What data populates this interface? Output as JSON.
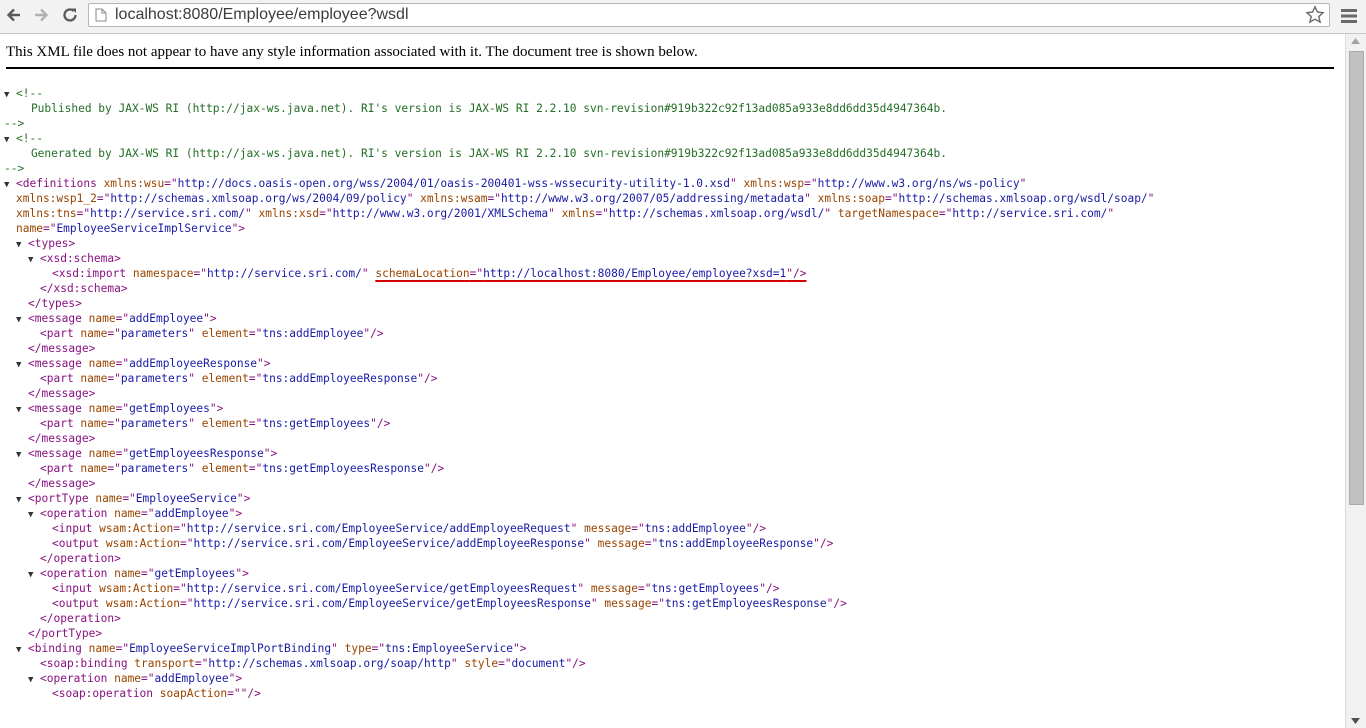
{
  "browser": {
    "url": "localhost:8080/Employee/employee?wsdl"
  },
  "info_text": "This XML file does not appear to have any style information associated with it. The document tree is shown below.",
  "lines": [
    {
      "indent": 0,
      "toggle": "▼",
      "parts": [
        {
          "c": "cm",
          "t": "<!--"
        }
      ]
    },
    {
      "indent": 0,
      "toggle": "",
      "parts": [
        {
          "c": "cm",
          "t": "    Published by JAX-WS RI (http://jax-ws.java.net). RI's version is JAX-WS RI 2.2.10 svn-revision#919b322c92f13ad085a933e8dd6dd35d4947364b."
        }
      ]
    },
    {
      "indent": 0,
      "toggle": "",
      "parts": [
        {
          "c": "cm",
          "t": "-->"
        }
      ]
    },
    {
      "indent": 0,
      "toggle": "▼",
      "parts": [
        {
          "c": "cm",
          "t": "<!--"
        }
      ]
    },
    {
      "indent": 0,
      "toggle": "",
      "parts": [
        {
          "c": "cm",
          "t": "    Generated by JAX-WS RI (http://jax-ws.java.net). RI's version is JAX-WS RI 2.2.10 svn-revision#919b322c92f13ad085a933e8dd6dd35d4947364b."
        }
      ]
    },
    {
      "indent": 0,
      "toggle": "",
      "parts": [
        {
          "c": "cm",
          "t": "-->"
        }
      ]
    },
    {
      "indent": 0,
      "toggle": "▼",
      "parts": [
        {
          "c": "tag",
          "t": "<definitions"
        },
        {
          "c": "an",
          "t": " xmlns:wsu"
        },
        {
          "c": "tag",
          "t": "=\""
        },
        {
          "c": "av",
          "t": "http://docs.oasis-open.org/wss/2004/01/oasis-200401-wss-wssecurity-utility-1.0.xsd"
        },
        {
          "c": "tag",
          "t": "\""
        },
        {
          "c": "an",
          "t": " xmlns:wsp"
        },
        {
          "c": "tag",
          "t": "=\""
        },
        {
          "c": "av",
          "t": "http://www.w3.org/ns/ws-policy"
        },
        {
          "c": "tag",
          "t": "\""
        }
      ]
    },
    {
      "indent": 1,
      "toggle": "",
      "parts": [
        {
          "c": "an",
          "t": "xmlns:wsp1_2"
        },
        {
          "c": "tag",
          "t": "=\""
        },
        {
          "c": "av",
          "t": "http://schemas.xmlsoap.org/ws/2004/09/policy"
        },
        {
          "c": "tag",
          "t": "\""
        },
        {
          "c": "an",
          "t": " xmlns:wsam"
        },
        {
          "c": "tag",
          "t": "=\""
        },
        {
          "c": "av",
          "t": "http://www.w3.org/2007/05/addressing/metadata"
        },
        {
          "c": "tag",
          "t": "\""
        },
        {
          "c": "an",
          "t": " xmlns:soap"
        },
        {
          "c": "tag",
          "t": "=\""
        },
        {
          "c": "av",
          "t": "http://schemas.xmlsoap.org/wsdl/soap/"
        },
        {
          "c": "tag",
          "t": "\""
        }
      ]
    },
    {
      "indent": 1,
      "toggle": "",
      "parts": [
        {
          "c": "an",
          "t": "xmlns:tns"
        },
        {
          "c": "tag",
          "t": "=\""
        },
        {
          "c": "av",
          "t": "http://service.sri.com/"
        },
        {
          "c": "tag",
          "t": "\""
        },
        {
          "c": "an",
          "t": " xmlns:xsd"
        },
        {
          "c": "tag",
          "t": "=\""
        },
        {
          "c": "av",
          "t": "http://www.w3.org/2001/XMLSchema"
        },
        {
          "c": "tag",
          "t": "\""
        },
        {
          "c": "an",
          "t": " xmlns"
        },
        {
          "c": "tag",
          "t": "=\""
        },
        {
          "c": "av",
          "t": "http://schemas.xmlsoap.org/wsdl/"
        },
        {
          "c": "tag",
          "t": "\""
        },
        {
          "c": "an",
          "t": " targetNamespace"
        },
        {
          "c": "tag",
          "t": "=\""
        },
        {
          "c": "av",
          "t": "http://service.sri.com/"
        },
        {
          "c": "tag",
          "t": "\""
        }
      ]
    },
    {
      "indent": 1,
      "toggle": "",
      "parts": [
        {
          "c": "an",
          "t": "name"
        },
        {
          "c": "tag",
          "t": "=\""
        },
        {
          "c": "av",
          "t": "EmployeeServiceImplService"
        },
        {
          "c": "tag",
          "t": "\">"
        }
      ]
    },
    {
      "indent": 1,
      "toggle": "▼",
      "parts": [
        {
          "c": "tag",
          "t": "<types>"
        }
      ]
    },
    {
      "indent": 2,
      "toggle": "▼",
      "parts": [
        {
          "c": "tag",
          "t": "<xsd:schema>"
        }
      ]
    },
    {
      "indent": 4,
      "toggle": "",
      "parts": [
        {
          "c": "tag",
          "t": "<xsd:import"
        },
        {
          "c": "an",
          "t": " namespace"
        },
        {
          "c": "tag",
          "t": "=\""
        },
        {
          "c": "av",
          "t": "http://service.sri.com/"
        },
        {
          "c": "tag",
          "t": "\" "
        },
        {
          "c": "an",
          "t": "schemaLocation",
          "u": 1
        },
        {
          "c": "tag",
          "t": "=\"",
          "u": 1
        },
        {
          "c": "av",
          "t": "http://localhost:8080/Employee/employee?xsd=1",
          "u": 1
        },
        {
          "c": "tag",
          "t": "\"/>",
          "u": 1
        }
      ]
    },
    {
      "indent": 3,
      "toggle": "",
      "parts": [
        {
          "c": "tag",
          "t": "</xsd:schema>"
        }
      ]
    },
    {
      "indent": 2,
      "toggle": "",
      "parts": [
        {
          "c": "tag",
          "t": "</types>"
        }
      ]
    },
    {
      "indent": 1,
      "toggle": "▼",
      "parts": [
        {
          "c": "tag",
          "t": "<message"
        },
        {
          "c": "an",
          "t": " name"
        },
        {
          "c": "tag",
          "t": "=\""
        },
        {
          "c": "av",
          "t": "addEmployee"
        },
        {
          "c": "tag",
          "t": "\">"
        }
      ]
    },
    {
      "indent": 3,
      "toggle": "",
      "parts": [
        {
          "c": "tag",
          "t": "<part"
        },
        {
          "c": "an",
          "t": " name"
        },
        {
          "c": "tag",
          "t": "=\""
        },
        {
          "c": "av",
          "t": "parameters"
        },
        {
          "c": "tag",
          "t": "\""
        },
        {
          "c": "an",
          "t": " element"
        },
        {
          "c": "tag",
          "t": "=\""
        },
        {
          "c": "av",
          "t": "tns:addEmployee"
        },
        {
          "c": "tag",
          "t": "\"/>"
        }
      ]
    },
    {
      "indent": 2,
      "toggle": "",
      "parts": [
        {
          "c": "tag",
          "t": "</message>"
        }
      ]
    },
    {
      "indent": 1,
      "toggle": "▼",
      "parts": [
        {
          "c": "tag",
          "t": "<message"
        },
        {
          "c": "an",
          "t": " name"
        },
        {
          "c": "tag",
          "t": "=\""
        },
        {
          "c": "av",
          "t": "addEmployeeResponse"
        },
        {
          "c": "tag",
          "t": "\">"
        }
      ]
    },
    {
      "indent": 3,
      "toggle": "",
      "parts": [
        {
          "c": "tag",
          "t": "<part"
        },
        {
          "c": "an",
          "t": " name"
        },
        {
          "c": "tag",
          "t": "=\""
        },
        {
          "c": "av",
          "t": "parameters"
        },
        {
          "c": "tag",
          "t": "\""
        },
        {
          "c": "an",
          "t": " element"
        },
        {
          "c": "tag",
          "t": "=\""
        },
        {
          "c": "av",
          "t": "tns:addEmployeeResponse"
        },
        {
          "c": "tag",
          "t": "\"/>"
        }
      ]
    },
    {
      "indent": 2,
      "toggle": "",
      "parts": [
        {
          "c": "tag",
          "t": "</message>"
        }
      ]
    },
    {
      "indent": 1,
      "toggle": "▼",
      "parts": [
        {
          "c": "tag",
          "t": "<message"
        },
        {
          "c": "an",
          "t": " name"
        },
        {
          "c": "tag",
          "t": "=\""
        },
        {
          "c": "av",
          "t": "getEmployees"
        },
        {
          "c": "tag",
          "t": "\">"
        }
      ]
    },
    {
      "indent": 3,
      "toggle": "",
      "parts": [
        {
          "c": "tag",
          "t": "<part"
        },
        {
          "c": "an",
          "t": " name"
        },
        {
          "c": "tag",
          "t": "=\""
        },
        {
          "c": "av",
          "t": "parameters"
        },
        {
          "c": "tag",
          "t": "\""
        },
        {
          "c": "an",
          "t": " element"
        },
        {
          "c": "tag",
          "t": "=\""
        },
        {
          "c": "av",
          "t": "tns:getEmployees"
        },
        {
          "c": "tag",
          "t": "\"/>"
        }
      ]
    },
    {
      "indent": 2,
      "toggle": "",
      "parts": [
        {
          "c": "tag",
          "t": "</message>"
        }
      ]
    },
    {
      "indent": 1,
      "toggle": "▼",
      "parts": [
        {
          "c": "tag",
          "t": "<message"
        },
        {
          "c": "an",
          "t": " name"
        },
        {
          "c": "tag",
          "t": "=\""
        },
        {
          "c": "av",
          "t": "getEmployeesResponse"
        },
        {
          "c": "tag",
          "t": "\">"
        }
      ]
    },
    {
      "indent": 3,
      "toggle": "",
      "parts": [
        {
          "c": "tag",
          "t": "<part"
        },
        {
          "c": "an",
          "t": " name"
        },
        {
          "c": "tag",
          "t": "=\""
        },
        {
          "c": "av",
          "t": "parameters"
        },
        {
          "c": "tag",
          "t": "\""
        },
        {
          "c": "an",
          "t": " element"
        },
        {
          "c": "tag",
          "t": "=\""
        },
        {
          "c": "av",
          "t": "tns:getEmployeesResponse"
        },
        {
          "c": "tag",
          "t": "\"/>"
        }
      ]
    },
    {
      "indent": 2,
      "toggle": "",
      "parts": [
        {
          "c": "tag",
          "t": "</message>"
        }
      ]
    },
    {
      "indent": 1,
      "toggle": "▼",
      "parts": [
        {
          "c": "tag",
          "t": "<portType"
        },
        {
          "c": "an",
          "t": " name"
        },
        {
          "c": "tag",
          "t": "=\""
        },
        {
          "c": "av",
          "t": "EmployeeService"
        },
        {
          "c": "tag",
          "t": "\">"
        }
      ]
    },
    {
      "indent": 2,
      "toggle": "▼",
      "parts": [
        {
          "c": "tag",
          "t": "<operation"
        },
        {
          "c": "an",
          "t": " name"
        },
        {
          "c": "tag",
          "t": "=\""
        },
        {
          "c": "av",
          "t": "addEmployee"
        },
        {
          "c": "tag",
          "t": "\">"
        }
      ]
    },
    {
      "indent": 4,
      "toggle": "",
      "parts": [
        {
          "c": "tag",
          "t": "<input"
        },
        {
          "c": "an",
          "t": " wsam:Action"
        },
        {
          "c": "tag",
          "t": "=\""
        },
        {
          "c": "av",
          "t": "http://service.sri.com/EmployeeService/addEmployeeRequest"
        },
        {
          "c": "tag",
          "t": "\""
        },
        {
          "c": "an",
          "t": " message"
        },
        {
          "c": "tag",
          "t": "=\""
        },
        {
          "c": "av",
          "t": "tns:addEmployee"
        },
        {
          "c": "tag",
          "t": "\"/>"
        }
      ]
    },
    {
      "indent": 4,
      "toggle": "",
      "parts": [
        {
          "c": "tag",
          "t": "<output"
        },
        {
          "c": "an",
          "t": " wsam:Action"
        },
        {
          "c": "tag",
          "t": "=\""
        },
        {
          "c": "av",
          "t": "http://service.sri.com/EmployeeService/addEmployeeResponse"
        },
        {
          "c": "tag",
          "t": "\""
        },
        {
          "c": "an",
          "t": " message"
        },
        {
          "c": "tag",
          "t": "=\""
        },
        {
          "c": "av",
          "t": "tns:addEmployeeResponse"
        },
        {
          "c": "tag",
          "t": "\"/>"
        }
      ]
    },
    {
      "indent": 3,
      "toggle": "",
      "parts": [
        {
          "c": "tag",
          "t": "</operation>"
        }
      ]
    },
    {
      "indent": 2,
      "toggle": "▼",
      "parts": [
        {
          "c": "tag",
          "t": "<operation"
        },
        {
          "c": "an",
          "t": " name"
        },
        {
          "c": "tag",
          "t": "=\""
        },
        {
          "c": "av",
          "t": "getEmployees"
        },
        {
          "c": "tag",
          "t": "\">"
        }
      ]
    },
    {
      "indent": 4,
      "toggle": "",
      "parts": [
        {
          "c": "tag",
          "t": "<input"
        },
        {
          "c": "an",
          "t": " wsam:Action"
        },
        {
          "c": "tag",
          "t": "=\""
        },
        {
          "c": "av",
          "t": "http://service.sri.com/EmployeeService/getEmployeesRequest"
        },
        {
          "c": "tag",
          "t": "\""
        },
        {
          "c": "an",
          "t": " message"
        },
        {
          "c": "tag",
          "t": "=\""
        },
        {
          "c": "av",
          "t": "tns:getEmployees"
        },
        {
          "c": "tag",
          "t": "\"/>"
        }
      ]
    },
    {
      "indent": 4,
      "toggle": "",
      "parts": [
        {
          "c": "tag",
          "t": "<output"
        },
        {
          "c": "an",
          "t": " wsam:Action"
        },
        {
          "c": "tag",
          "t": "=\""
        },
        {
          "c": "av",
          "t": "http://service.sri.com/EmployeeService/getEmployeesResponse"
        },
        {
          "c": "tag",
          "t": "\""
        },
        {
          "c": "an",
          "t": " message"
        },
        {
          "c": "tag",
          "t": "=\""
        },
        {
          "c": "av",
          "t": "tns:getEmployeesResponse"
        },
        {
          "c": "tag",
          "t": "\"/>"
        }
      ]
    },
    {
      "indent": 3,
      "toggle": "",
      "parts": [
        {
          "c": "tag",
          "t": "</operation>"
        }
      ]
    },
    {
      "indent": 2,
      "toggle": "",
      "parts": [
        {
          "c": "tag",
          "t": "</portType>"
        }
      ]
    },
    {
      "indent": 1,
      "toggle": "▼",
      "parts": [
        {
          "c": "tag",
          "t": "<binding"
        },
        {
          "c": "an",
          "t": " name"
        },
        {
          "c": "tag",
          "t": "=\""
        },
        {
          "c": "av",
          "t": "EmployeeServiceImplPortBinding"
        },
        {
          "c": "tag",
          "t": "\""
        },
        {
          "c": "an",
          "t": " type"
        },
        {
          "c": "tag",
          "t": "=\""
        },
        {
          "c": "av",
          "t": "tns:EmployeeService"
        },
        {
          "c": "tag",
          "t": "\">"
        }
      ]
    },
    {
      "indent": 3,
      "toggle": "",
      "parts": [
        {
          "c": "tag",
          "t": "<soap:binding"
        },
        {
          "c": "an",
          "t": " transport"
        },
        {
          "c": "tag",
          "t": "=\""
        },
        {
          "c": "av",
          "t": "http://schemas.xmlsoap.org/soap/http"
        },
        {
          "c": "tag",
          "t": "\""
        },
        {
          "c": "an",
          "t": " style"
        },
        {
          "c": "tag",
          "t": "=\""
        },
        {
          "c": "av",
          "t": "document"
        },
        {
          "c": "tag",
          "t": "\"/>"
        }
      ]
    },
    {
      "indent": 2,
      "toggle": "▼",
      "parts": [
        {
          "c": "tag",
          "t": "<operation"
        },
        {
          "c": "an",
          "t": " name"
        },
        {
          "c": "tag",
          "t": "=\""
        },
        {
          "c": "av",
          "t": "addEmployee"
        },
        {
          "c": "tag",
          "t": "\">"
        }
      ]
    },
    {
      "indent": 4,
      "toggle": "",
      "parts": [
        {
          "c": "tag",
          "t": "<soap:operation"
        },
        {
          "c": "an",
          "t": " soapAction"
        },
        {
          "c": "tag",
          "t": "=\"\"/>"
        }
      ]
    }
  ]
}
